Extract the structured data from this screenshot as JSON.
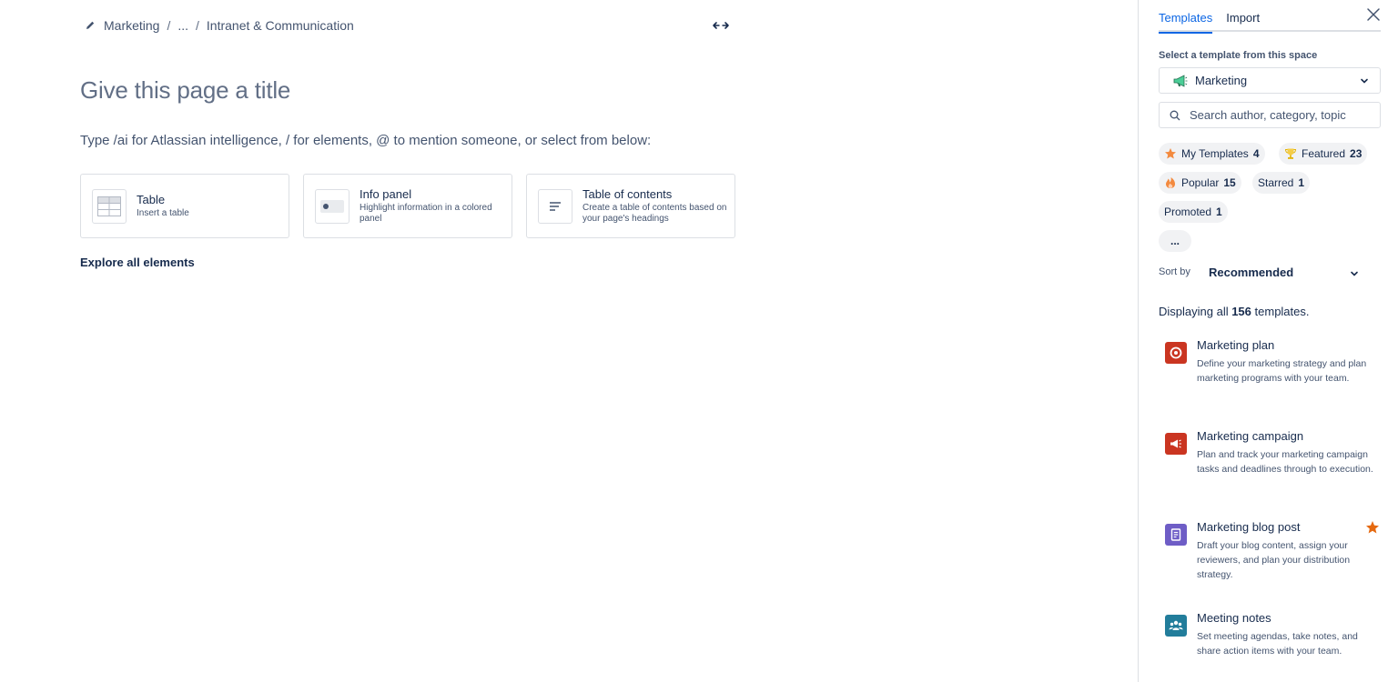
{
  "breadcrumb": {
    "items": [
      "Marketing",
      "...",
      "Intranet & Communication"
    ],
    "separator": "/"
  },
  "editor": {
    "title_placeholder": "Give this page a title",
    "hint": "Type /ai for Atlassian intelligence, / for elements, @ to mention someone, or select from below:",
    "cards": [
      {
        "icon": "table-icon",
        "title": "Table",
        "desc": "Insert a table"
      },
      {
        "icon": "info-panel-icon",
        "title": "Info panel",
        "desc": "Highlight information in a colored panel"
      },
      {
        "icon": "table-of-contents-icon",
        "title": "Table of contents",
        "desc": "Create a table of contents based on your page's headings"
      }
    ],
    "explore": "Explore all elements"
  },
  "panel": {
    "tabs": [
      "Templates",
      "Import"
    ],
    "select_label": "Select a template from this space",
    "space": "Marketing",
    "search_placeholder": "Search author, category, topic",
    "filters": [
      {
        "label": "My Templates",
        "count": "4",
        "icon": "star-icon"
      },
      {
        "label": "Featured",
        "count": "23",
        "icon": "trophy-icon"
      },
      {
        "label": "Popular",
        "count": "15",
        "icon": "fire-icon"
      },
      {
        "label": "Starred",
        "count": "1"
      },
      {
        "label": "Promoted",
        "count": "1"
      },
      {
        "label": "..."
      }
    ],
    "sort_label": "Sort by",
    "sort_value": "Recommended",
    "display_prefix": "Displaying all ",
    "display_count": "156",
    "display_suffix": " templates.",
    "templates": [
      {
        "name": "Marketing plan",
        "desc": "Define your marketing strategy and plan marketing programs with your team.",
        "icon": "target-icon",
        "color": "#ca3521"
      },
      {
        "name": "Marketing campaign",
        "desc": "Plan and track your marketing campaign tasks and deadlines through to execution.",
        "icon": "megaphone-icon",
        "color": "#ca3521"
      },
      {
        "name": "Marketing blog post",
        "desc": "Draft your blog content, assign your reviewers, and plan your distribution strategy.",
        "icon": "document-icon",
        "color": "#6e5dc6",
        "starred": true
      },
      {
        "name": "Meeting notes",
        "desc": "Set meeting agendas, take notes, and share action items with your team.",
        "icon": "people-icon",
        "color": "#227d9b"
      }
    ]
  },
  "colors": {
    "accent": "#0c66e4",
    "star": "#e56910"
  }
}
